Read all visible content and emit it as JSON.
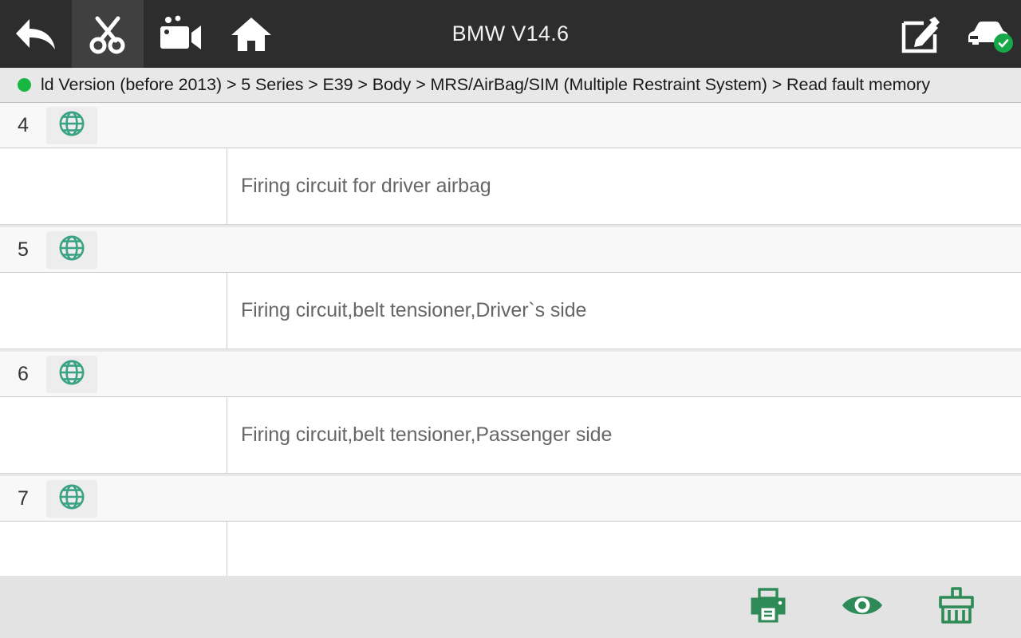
{
  "header": {
    "title": "BMW V14.6",
    "left_buttons": [
      {
        "name": "back-button",
        "icon": "back-arrow-icon",
        "active": false
      },
      {
        "name": "scissors-button",
        "icon": "scissors-icon",
        "active": true
      },
      {
        "name": "record-button",
        "icon": "video-camera-icon",
        "active": false
      },
      {
        "name": "home-button",
        "icon": "home-icon",
        "active": false
      }
    ],
    "right_buttons": [
      {
        "name": "edit-button",
        "icon": "edit-square-pencil-icon"
      },
      {
        "name": "vehicle-status-button",
        "icon": "car-icon",
        "badge": "check-icon"
      }
    ],
    "background_color": "#2d2d2d",
    "active_button_color": "#404040"
  },
  "breadcrumb": {
    "status_indicator": "connected",
    "status_color": "#17b741",
    "path": "ld Version (before 2013) > 5 Series > E39 > Body > MRS/AirBag/SIM (Multiple Restraint System) > Read fault memory"
  },
  "fault_list": {
    "icon": "globe-icon",
    "icon_color": "#3aa384",
    "rows": [
      {
        "index": "4",
        "description": "Firing circuit for driver airbag"
      },
      {
        "index": "5",
        "description": "Firing circuit,belt tensioner,Driver`s side"
      },
      {
        "index": "6",
        "description": "Firing circuit,belt tensioner,Passenger side"
      },
      {
        "index": "7",
        "description": ""
      }
    ]
  },
  "bottom_toolbar": {
    "background_color": "#e3e3e3",
    "icon_color": "#2e8b57",
    "buttons": [
      {
        "name": "print-button",
        "icon": "printer-icon"
      },
      {
        "name": "view-button",
        "icon": "eye-icon"
      },
      {
        "name": "clear-button",
        "icon": "brush-icon"
      }
    ]
  }
}
